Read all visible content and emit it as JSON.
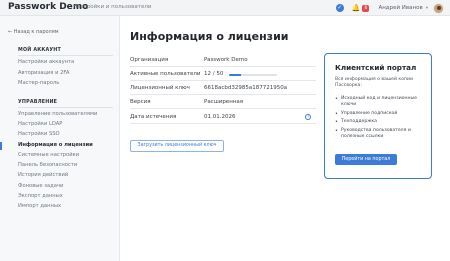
{
  "header": {
    "brand": "Passwork Demo",
    "breadcrumb": "Настройки и пользователи",
    "notifications_count": "6",
    "user_name": "Андрей Иванов",
    "icons": {
      "check": "check-circle-icon",
      "bell": "bell-icon",
      "caret": "chevron-down-icon",
      "avatar": "avatar"
    }
  },
  "sidebar": {
    "back_label": "← Назад к паролям",
    "sections": [
      {
        "title": "МОЙ АККАУНТ",
        "items": [
          "Настройки аккаунта",
          "Авторизация и 2FA",
          "Мастер-пароль"
        ]
      },
      {
        "title": "УПРАВЛЕНИЕ",
        "items": [
          "Управление пользователями",
          "Настройки LDAP",
          "Настройки SSO",
          "Информация о лицензии",
          "Системные настройки",
          "Панель безопасности",
          "История действий",
          "Фоновые задачи",
          "Экспорт данных",
          "Импорт данных"
        ]
      }
    ],
    "active_item": "Информация о лицензии"
  },
  "main": {
    "title": "Информация о лицензии",
    "fields": [
      {
        "label": "Организация",
        "value": "Passwork Demo"
      },
      {
        "label": "Активные пользователи",
        "value": "12 / 50"
      },
      {
        "label": "Лицензионный ключ",
        "value": "6618acbd32985a187721950a"
      },
      {
        "label": "Версия",
        "value": "Расширенная"
      },
      {
        "label": "Дата истечения",
        "value": "01.01.2026"
      }
    ],
    "users_progress_fraction": 0.24,
    "help_icon": "help-circle-icon",
    "load_button": "Загрузить лицензионный ключ"
  },
  "portal": {
    "title": "Клиентский портал",
    "description": "Вся информация о вашей копии Пассворка:",
    "items": [
      "Исходный код и лицензионные ключи",
      "Управление подпиской",
      "Техподдержка",
      "Руководства пользователя и полезные ссылки"
    ],
    "button": "Перейти на портал"
  },
  "colors": {
    "accent": "#3d7bd9",
    "badge": "#e5484d",
    "sidebar_bg": "#f7f8f9"
  }
}
